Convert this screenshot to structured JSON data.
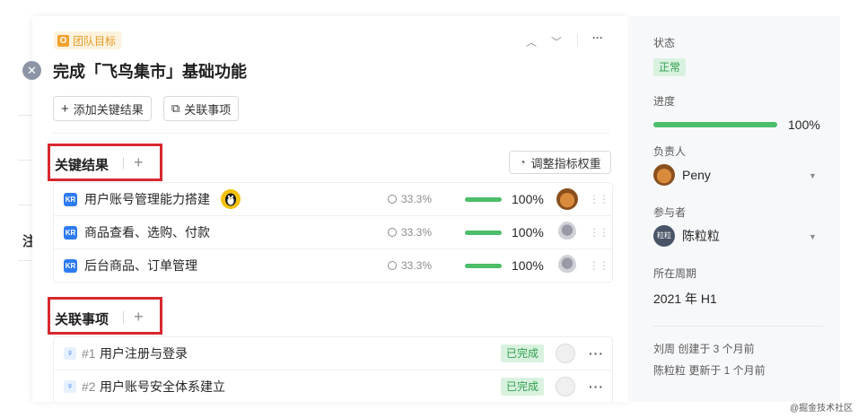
{
  "background": {
    "text": "注"
  },
  "header": {
    "tag_icon": "O",
    "tag_label": "团队目标",
    "title": "完成「飞鸟集市」基础功能"
  },
  "toolbar": {
    "add_key_result_label": "添加关键结果",
    "link_item_label": "关联事项"
  },
  "key_results_section": {
    "title": "关键结果",
    "adjust_weight_label": "调整指标权重",
    "rows": [
      {
        "badge": "KR",
        "title": "用户账号管理能力搭建",
        "weight": "33.3%",
        "progress": "100%"
      },
      {
        "badge": "KR",
        "title": "商品查看、选购、付款",
        "weight": "33.3%",
        "progress": "100%"
      },
      {
        "badge": "KR",
        "title": "后台商品、订单管理",
        "weight": "33.3%",
        "progress": "100%"
      }
    ]
  },
  "linked_section": {
    "title": "关联事项",
    "rows": [
      {
        "number": "#1",
        "title": "用户注册与登录",
        "status": "已完成"
      },
      {
        "number": "#2",
        "title": "用户账号安全体系建立",
        "status": "已完成"
      }
    ]
  },
  "sidebar": {
    "status_label": "状态",
    "status_value": "正常",
    "progress_label": "进度",
    "progress_value": "100%",
    "owner_label": "负责人",
    "owner_name": "Peny",
    "participants_label": "参与者",
    "participant_avatar_text": "粒粒",
    "participant_name": "陈粒粒",
    "period_label": "所在周期",
    "period_value": "2021 年 H1",
    "log_created": "刘周 创建于 3 个月前",
    "log_updated": "陈粒粒 更新于 1 个月前"
  },
  "watermark": "@掘金技术社区",
  "colors": {
    "accent_green": "#4cbd6a",
    "kr_blue": "#2d7bf0",
    "highlight_red": "#d7282f",
    "tag_orange": "#f0a12b"
  }
}
